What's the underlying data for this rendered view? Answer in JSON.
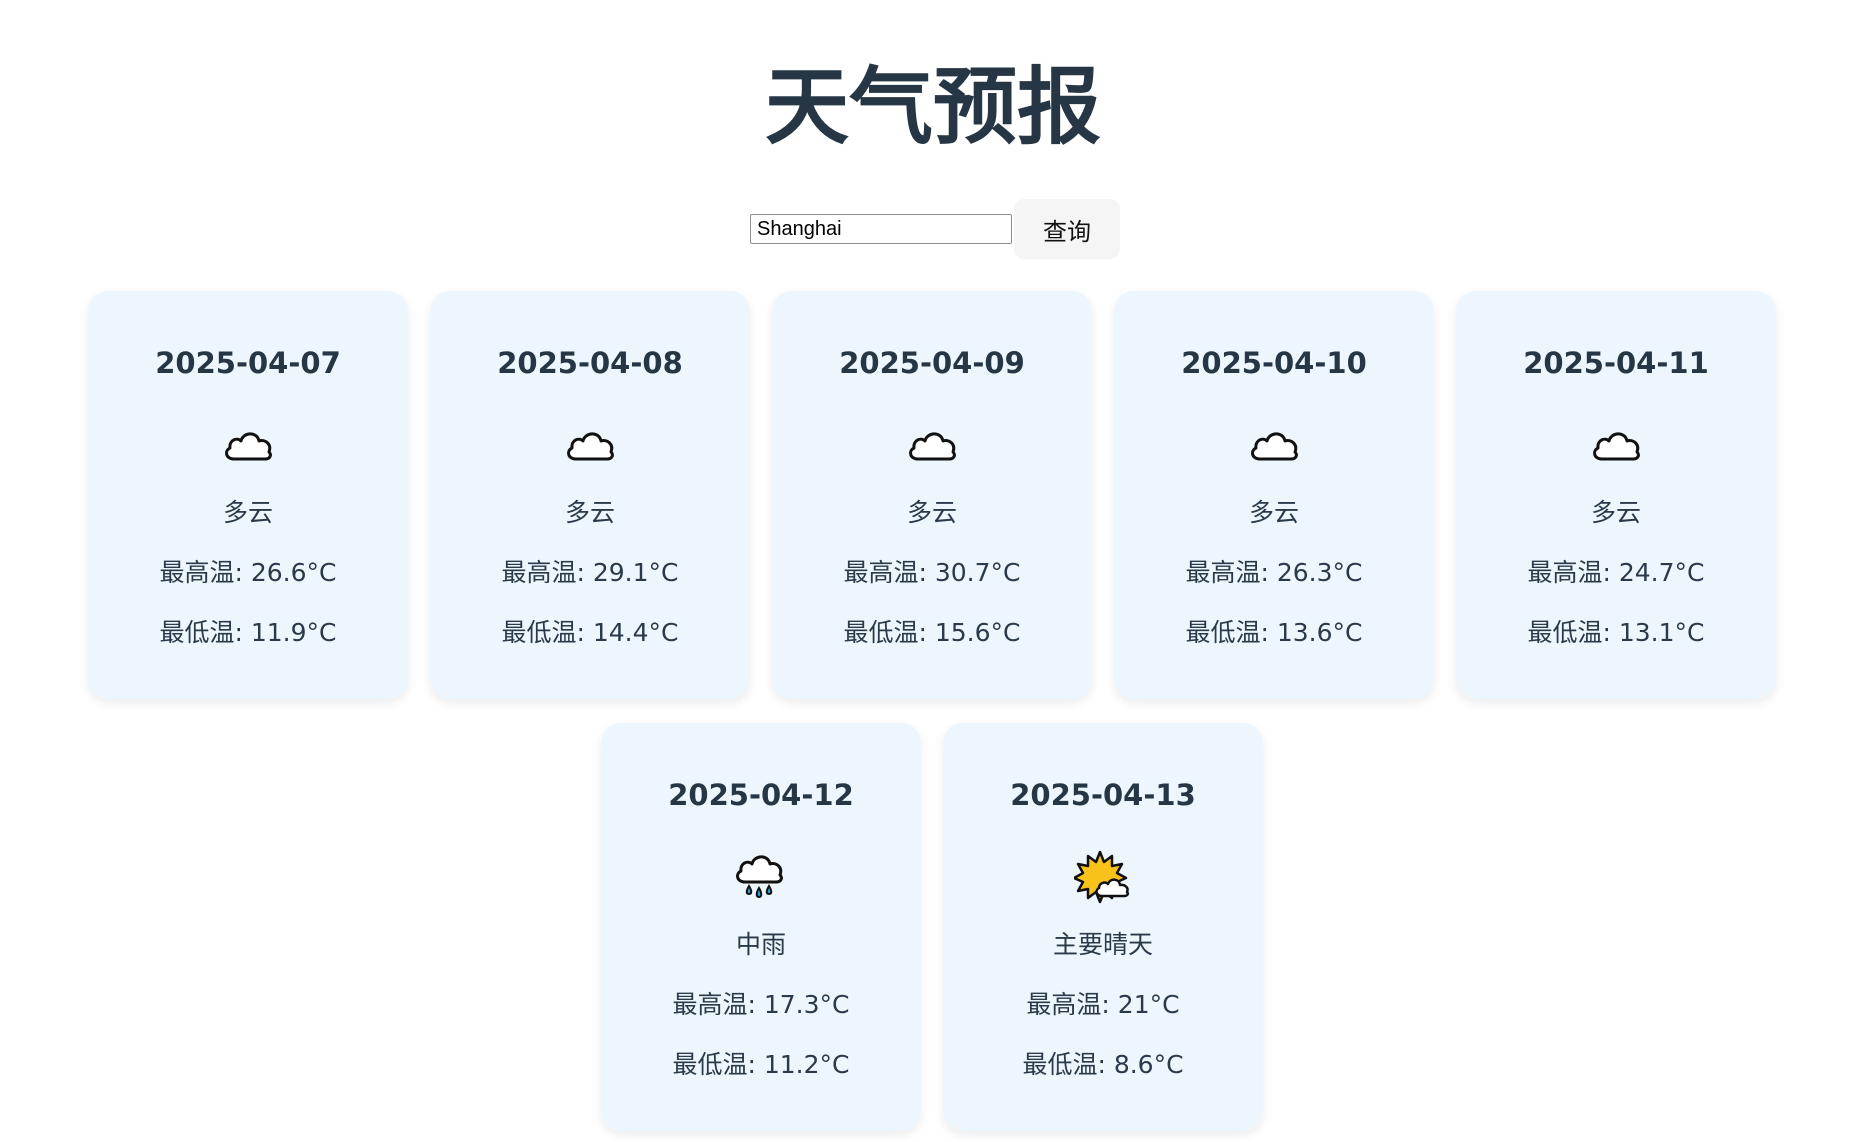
{
  "header": {
    "title": "天气预报"
  },
  "search": {
    "value": "Shanghai",
    "button_label": "查询"
  },
  "colors": {
    "card_background": "#eef6fd",
    "title_color": "#263645"
  },
  "forecast": [
    {
      "date": "2025-04-07",
      "icon": "cloud-icon",
      "desc": "多云",
      "high": "最高温: 26.6°C",
      "low": "最低温: 11.9°C"
    },
    {
      "date": "2025-04-08",
      "icon": "cloud-icon",
      "desc": "多云",
      "high": "最高温: 29.1°C",
      "low": "最低温: 14.4°C"
    },
    {
      "date": "2025-04-09",
      "icon": "cloud-icon",
      "desc": "多云",
      "high": "最高温: 30.7°C",
      "low": "最低温: 15.6°C"
    },
    {
      "date": "2025-04-10",
      "icon": "cloud-icon",
      "desc": "多云",
      "high": "最高温: 26.3°C",
      "low": "最低温: 13.6°C"
    },
    {
      "date": "2025-04-11",
      "icon": "cloud-icon",
      "desc": "多云",
      "high": "最高温: 24.7°C",
      "low": "最低温: 13.1°C"
    },
    {
      "date": "2025-04-12",
      "icon": "rain-cloud-icon",
      "desc": "中雨",
      "high": "最高温: 17.3°C",
      "low": "最低温: 11.2°C"
    },
    {
      "date": "2025-04-13",
      "icon": "sun-behind-cloud-icon",
      "desc": "主要晴天",
      "high": "最高温: 21°C",
      "low": "最低温: 8.6°C"
    }
  ]
}
